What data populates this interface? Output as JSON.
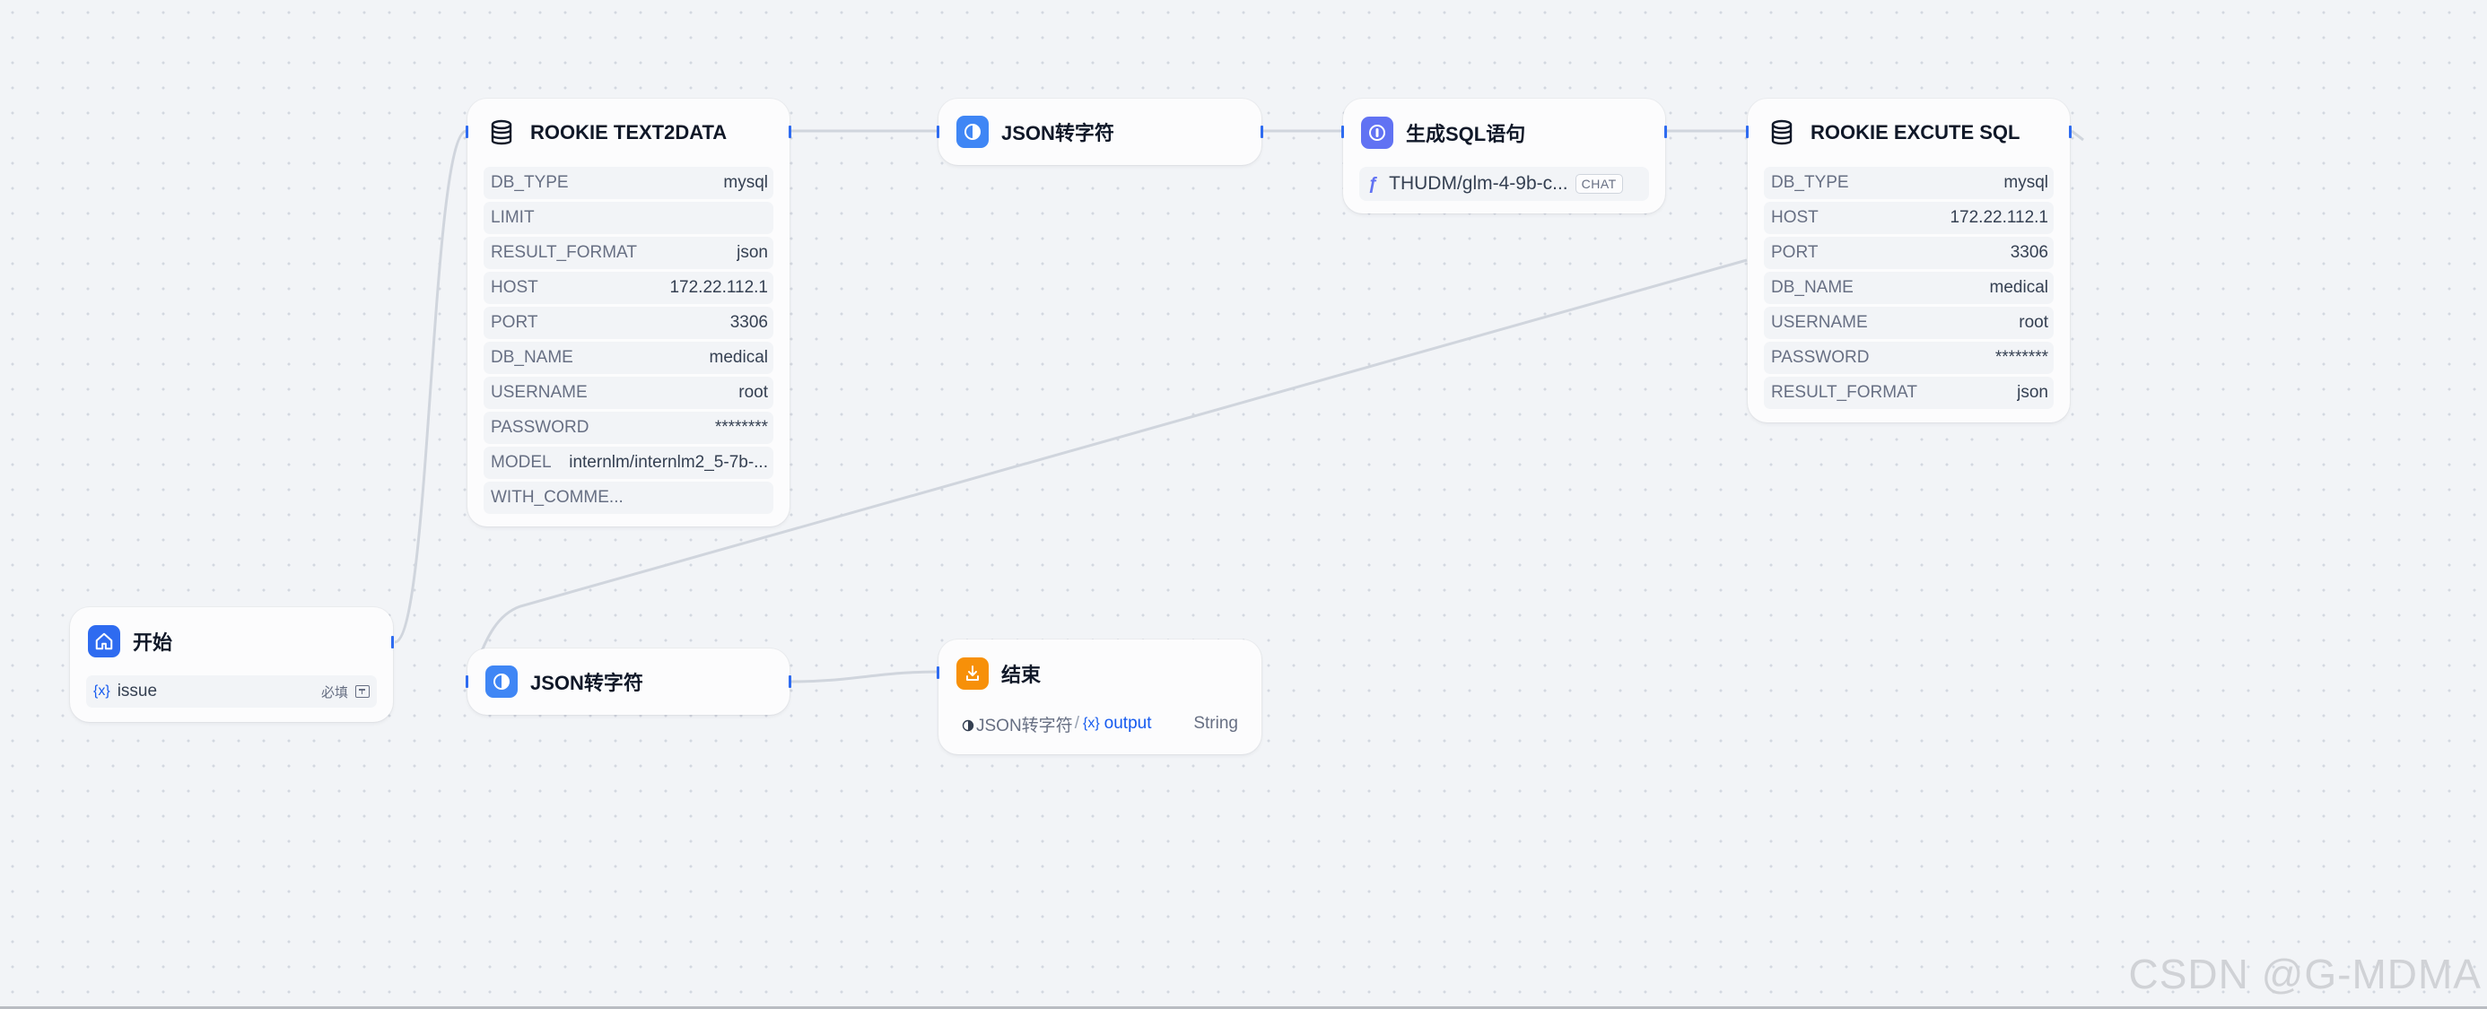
{
  "nodes": {
    "start": {
      "title": "开始",
      "var_icon": "{x}",
      "var_name": "issue",
      "required_label": "必填"
    },
    "text2data": {
      "title": "ROOKIE TEXT2DATA",
      "rows": [
        {
          "key": "DB_TYPE",
          "value": "mysql"
        },
        {
          "key": "LIMIT",
          "value": ""
        },
        {
          "key": "RESULT_FORMAT",
          "value": "json"
        },
        {
          "key": "HOST",
          "value": "172.22.112.1"
        },
        {
          "key": "PORT",
          "value": "3306"
        },
        {
          "key": "DB_NAME",
          "value": "medical"
        },
        {
          "key": "USERNAME",
          "value": "root"
        },
        {
          "key": "PASSWORD",
          "value": "********"
        },
        {
          "key": "MODEL",
          "value": "internlm/internlm2_5-7b-..."
        },
        {
          "key": "WITH_COMME...",
          "value": ""
        }
      ]
    },
    "json1": {
      "title": "JSON转字符"
    },
    "gensql": {
      "title": "生成SQL语句",
      "model": "THUDM/glm-4-9b-c...",
      "model_badge": "CHAT"
    },
    "execute": {
      "title": "ROOKIE EXCUTE SQL",
      "rows": [
        {
          "key": "DB_TYPE",
          "value": "mysql"
        },
        {
          "key": "HOST",
          "value": "172.22.112.1"
        },
        {
          "key": "PORT",
          "value": "3306"
        },
        {
          "key": "DB_NAME",
          "value": "medical"
        },
        {
          "key": "USERNAME",
          "value": "root"
        },
        {
          "key": "PASSWORD",
          "value": "********"
        },
        {
          "key": "RESULT_FORMAT",
          "value": "json"
        }
      ]
    },
    "json2": {
      "title": "JSON转字符"
    },
    "end": {
      "title": "结束",
      "source_node": "JSON转字符",
      "separator": "/",
      "var_icon": "{x}",
      "var_name": "output",
      "var_type": "String"
    }
  },
  "watermark": "CSDN @G-MDMA",
  "colors": {
    "handle": "#2e6bf0",
    "edge": "#d0d5dd",
    "start_icon": "#2e6bf0",
    "json_icon": "#3f86f5",
    "llm_icon": "#6172f3",
    "end_icon": "#f79009"
  }
}
